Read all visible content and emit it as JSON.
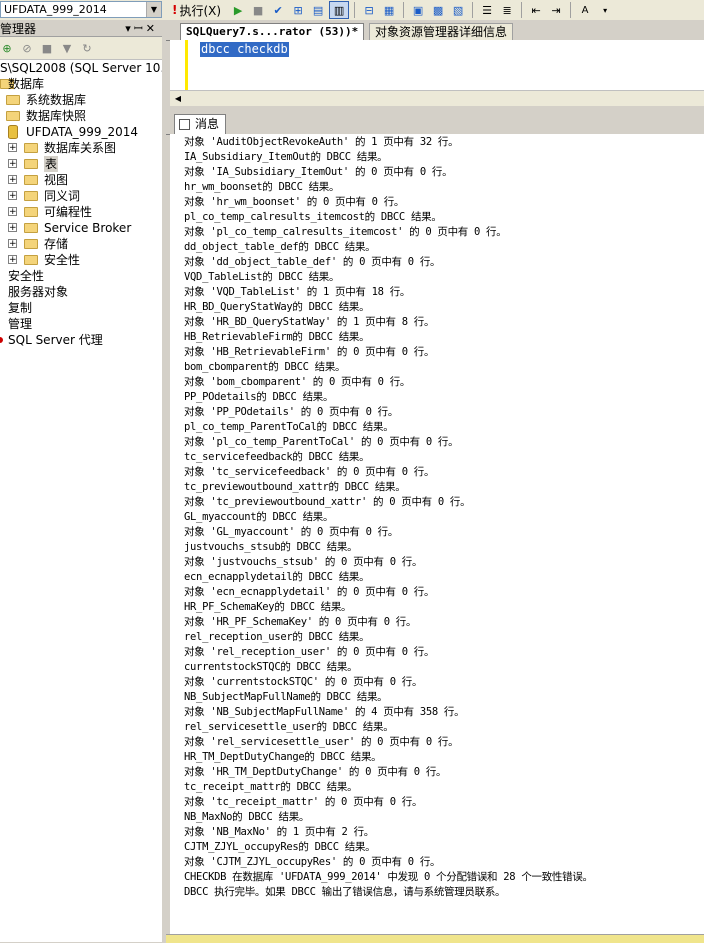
{
  "toolbar": {
    "database": "UFDATA_999_2014",
    "execute_label": "执行(X)",
    "icons": [
      "execute-icon",
      "debug-icon",
      "stop-icon",
      "parse-icon",
      "display-plan-icon",
      "query-designer-icon",
      "results-to-text-icon",
      "results-to-grid-icon",
      "results-to-file-icon",
      "comment-icon",
      "uncomment-icon",
      "indent-icon",
      "outdent-icon",
      "specify-values-icon"
    ]
  },
  "explorer": {
    "title": "管理器",
    "server": "S\\SQL2008 (SQL Server 10.50",
    "nodes": [
      {
        "label": "数据库",
        "level": 0,
        "icon": "folder",
        "pm": "-"
      },
      {
        "label": "系统数据库",
        "level": 1,
        "icon": "folder",
        "pm": ""
      },
      {
        "label": "数据库快照",
        "level": 1,
        "icon": "folder",
        "pm": ""
      },
      {
        "label": "UFDATA_999_2014",
        "level": 1,
        "icon": "database",
        "pm": ""
      },
      {
        "label": "数据库关系图",
        "level": 2,
        "icon": "folder",
        "pm": "+"
      },
      {
        "label": "表",
        "level": 2,
        "icon": "folder",
        "pm": "+",
        "selected": true
      },
      {
        "label": "视图",
        "level": 2,
        "icon": "folder",
        "pm": "+"
      },
      {
        "label": "同义词",
        "level": 2,
        "icon": "folder",
        "pm": "+"
      },
      {
        "label": "可编程性",
        "level": 2,
        "icon": "folder",
        "pm": "+"
      },
      {
        "label": "Service Broker",
        "level": 2,
        "icon": "folder",
        "pm": "+"
      },
      {
        "label": "存储",
        "level": 2,
        "icon": "folder",
        "pm": "+"
      },
      {
        "label": "安全性",
        "level": 2,
        "icon": "folder",
        "pm": "+"
      },
      {
        "label": "安全性",
        "level": 0,
        "icon": "none",
        "pm": ""
      },
      {
        "label": "服务器对象",
        "level": 0,
        "icon": "none",
        "pm": ""
      },
      {
        "label": "复制",
        "level": 0,
        "icon": "none",
        "pm": ""
      },
      {
        "label": "管理",
        "level": 0,
        "icon": "none",
        "pm": ""
      },
      {
        "label": "SQL Server 代理",
        "level": 0,
        "icon": "agent",
        "pm": ""
      }
    ]
  },
  "tabs": {
    "query_tab": "SQLQuery7.s...rator (53))*",
    "details_tab": "对象资源管理器详细信息"
  },
  "editor": {
    "code": "dbcc checkdb"
  },
  "results": {
    "tab_label": "消息",
    "lines": [
      "对象 'AuditObjectRevokeAuth' 的 1 页中有 32 行。",
      "IA_Subsidiary_ItemOut的 DBCC 结果。",
      "对象 'IA_Subsidiary_ItemOut' 的 0 页中有 0 行。",
      "hr_wm_boonset的 DBCC 结果。",
      "对象 'hr_wm_boonset' 的 0 页中有 0 行。",
      "pl_co_temp_calresults_itemcost的 DBCC 结果。",
      "对象 'pl_co_temp_calresults_itemcost' 的 0 页中有 0 行。",
      "dd_object_table_def的 DBCC 结果。",
      "对象 'dd_object_table_def' 的 0 页中有 0 行。",
      "VQD_TableList的 DBCC 结果。",
      "对象 'VQD_TableList' 的 1 页中有 18 行。",
      "HR_BD_QueryStatWay的 DBCC 结果。",
      "对象 'HR_BD_QueryStatWay' 的 1 页中有 8 行。",
      "HB_RetrievableFirm的 DBCC 结果。",
      "对象 'HB_RetrievableFirm' 的 0 页中有 0 行。",
      "bom_cbomparent的 DBCC 结果。",
      "对象 'bom_cbomparent' 的 0 页中有 0 行。",
      "PP_POdetails的 DBCC 结果。",
      "对象 'PP_POdetails' 的 0 页中有 0 行。",
      "pl_co_temp_ParentToCal的 DBCC 结果。",
      "对象 'pl_co_temp_ParentToCal' 的 0 页中有 0 行。",
      "tc_servicefeedback的 DBCC 结果。",
      "对象 'tc_servicefeedback' 的 0 页中有 0 行。",
      "tc_previewoutbound_xattr的 DBCC 结果。",
      "对象 'tc_previewoutbound_xattr' 的 0 页中有 0 行。",
      "GL_myaccount的 DBCC 结果。",
      "对象 'GL_myaccount' 的 0 页中有 0 行。",
      "justvouchs_stsub的 DBCC 结果。",
      "对象 'justvouchs_stsub' 的 0 页中有 0 行。",
      "ecn_ecnapplydetail的 DBCC 结果。",
      "对象 'ecn_ecnapplydetail' 的 0 页中有 0 行。",
      "HR_PF_SchemaKey的 DBCC 结果。",
      "对象 'HR_PF_SchemaKey' 的 0 页中有 0 行。",
      "rel_reception_user的 DBCC 结果。",
      "对象 'rel_reception_user' 的 0 页中有 0 行。",
      "currentstockSTQC的 DBCC 结果。",
      "对象 'currentstockSTQC' 的 0 页中有 0 行。",
      "NB_SubjectMapFullName的 DBCC 结果。",
      "对象 'NB_SubjectMapFullName' 的 4 页中有 358 行。",
      "rel_servicesettle_user的 DBCC 结果。",
      "对象 'rel_servicesettle_user' 的 0 页中有 0 行。",
      "HR_TM_DeptDutyChange的 DBCC 结果。",
      "对象 'HR_TM_DeptDutyChange' 的 0 页中有 0 行。",
      "tc_receipt_mattr的 DBCC 结果。",
      "对象 'tc_receipt_mattr' 的 0 页中有 0 行。",
      "NB_MaxNo的 DBCC 结果。",
      "对象 'NB_MaxNo' 的 1 页中有 2 行。",
      "CJTM_ZJYL_occupyRes的 DBCC 结果。",
      "对象 'CJTM_ZJYL_occupyRes' 的 0 页中有 0 行。",
      "CHECKDB 在数据库 'UFDATA_999_2014' 中发现 0 个分配错误和 28 个一致性错误。",
      "DBCC 执行完毕。如果 DBCC 输出了错误信息，请与系统管理员联系。"
    ]
  }
}
